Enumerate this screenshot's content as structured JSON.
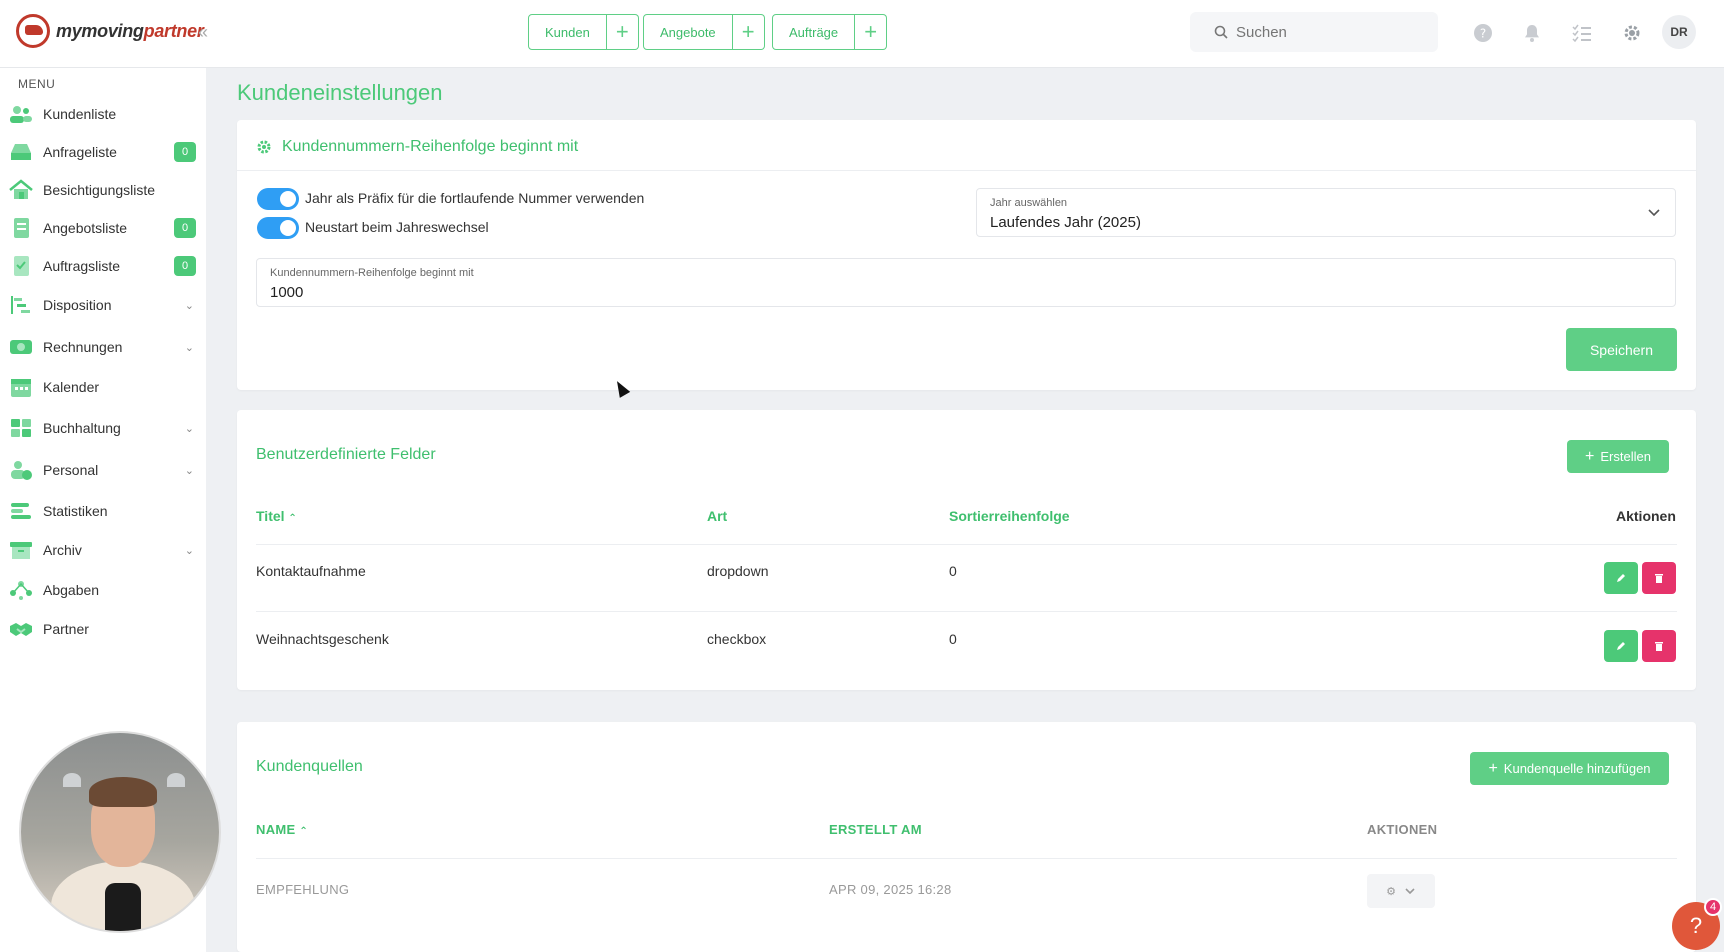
{
  "header": {
    "logo_text_a": "my",
    "logo_text_b": "moving",
    "logo_text_c": "partner",
    "collapse_icon": "«",
    "quick": [
      {
        "label": "Kunden",
        "plus": "+"
      },
      {
        "label": "Angebote",
        "plus": "+"
      },
      {
        "label": "Aufträge",
        "plus": "+"
      }
    ],
    "search_placeholder": "Suchen",
    "avatar": "DR"
  },
  "sidebar": {
    "menu_label": "MENU",
    "items": [
      {
        "label": "Kundenliste",
        "badge": "",
        "chev": ""
      },
      {
        "label": "Anfrageliste",
        "badge": "0",
        "chev": ""
      },
      {
        "label": "Besichtigungsliste",
        "badge": "",
        "chev": ""
      },
      {
        "label": "Angebotsliste",
        "badge": "0",
        "chev": ""
      },
      {
        "label": "Auftragsliste",
        "badge": "0",
        "chev": ""
      },
      {
        "label": "Disposition",
        "badge": "",
        "chev": "⌄"
      },
      {
        "label": "Rechnungen",
        "badge": "",
        "chev": "⌄"
      },
      {
        "label": "Kalender",
        "badge": "",
        "chev": ""
      },
      {
        "label": "Buchhaltung",
        "badge": "",
        "chev": "⌄"
      },
      {
        "label": "Personal",
        "badge": "",
        "chev": "⌄"
      },
      {
        "label": "Statistiken",
        "badge": "",
        "chev": ""
      },
      {
        "label": "Archiv",
        "badge": "",
        "chev": "⌄"
      },
      {
        "label": "Abgaben",
        "badge": "",
        "chev": ""
      },
      {
        "label": "Partner",
        "badge": "",
        "chev": ""
      }
    ]
  },
  "page": {
    "title": "Kundeneinstellungen"
  },
  "numbering": {
    "heading": "Kundennummern-Reihenfolge beginnt mit",
    "toggle1_label": "Jahr als Präfix für die fortlaufende Nummer verwenden",
    "toggle2_label": "Neustart beim Jahreswechsel",
    "year_select_label": "Jahr auswählen",
    "year_select_value": "Laufendes Jahr (2025)",
    "start_label": "Kundennummern-Reihenfolge beginnt mit",
    "start_value": "1000",
    "save_label": "Speichern"
  },
  "custom_fields": {
    "heading": "Benutzerdefinierte Felder",
    "create_label": "Erstellen",
    "columns": {
      "title": "Titel",
      "type": "Art",
      "sort": "Sortierreihenfolge",
      "actions": "Aktionen"
    },
    "rows": [
      {
        "title": "Kontaktaufnahme",
        "type": "dropdown",
        "sort": "0"
      },
      {
        "title": "Weihnachtsgeschenk",
        "type": "checkbox",
        "sort": "0"
      }
    ]
  },
  "sources": {
    "heading": "Kundenquellen",
    "add_label": "Kundenquelle hinzufügen",
    "columns": {
      "name": "NAME",
      "created": "ERSTELLT AM",
      "actions": "AKTIONEN"
    },
    "rows": [
      {
        "name": "EMPFEHLUNG",
        "created": "APR 09, 2025 16:28"
      }
    ]
  },
  "help": {
    "icon": "?",
    "badge": "4"
  },
  "colors": {
    "accent": "#4cc979",
    "danger": "#e6336b",
    "toggle": "#2f9ef4"
  }
}
